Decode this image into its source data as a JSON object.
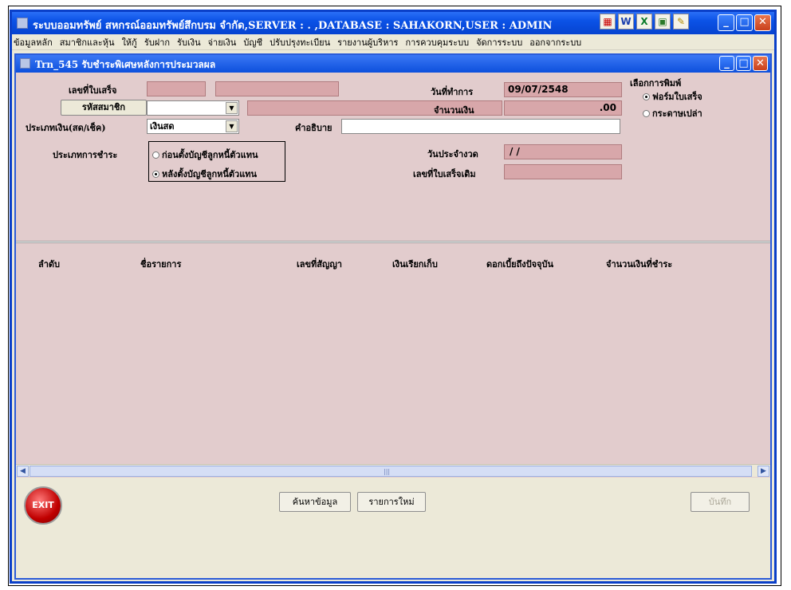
{
  "window": {
    "title": "ระบบออมทรัพย์  สหกรณ์ออมทรัพย์สึกบรม จำกัด,SERVER : . ,DATABASE : SAHAKORN,USER : ADMIN"
  },
  "toolbar_icons": [
    "grid-icon",
    "word-icon",
    "excel-icon",
    "calculator-icon",
    "key-icon"
  ],
  "menu": {
    "items": [
      "ข้อมูลหลัก",
      "สมาชิกและหุ้น",
      "ให้กู้",
      "รับฝาก",
      "รับเงิน",
      "จ่ายเงิน",
      "บัญชี",
      "ปรับปรุงทะเบียน",
      "รายงานผู้บริหาร",
      "การควบคุมระบบ",
      "จัดการระบบ",
      "ออกจากระบบ"
    ]
  },
  "form": {
    "title": "Trn_545 รับชำระพิเศษหลังการประมวลผล",
    "receipt_no_label": "เลขที่ใบเสร็จ",
    "member_code_button": "รหัสสมาชิก",
    "payment_type_label": "ประเภทเงิน(สด/เช็ค)",
    "payment_type_value": "เงินสด",
    "description_label": "คำอธิบาย",
    "payment_kind_label": "ประเภทการชำระ",
    "payment_kind_options": [
      "ก่อนตั้งบัญชีลูกหนี้ตัวแทน",
      "หลังตั้งบัญชีลูกหนี้ตัวแทน"
    ],
    "payment_kind_selected": 1,
    "transaction_date_label": "วันที่ทำการ",
    "transaction_date_value": "09/07/2548",
    "amount_label": "จำนวนเงิน",
    "amount_value": ".00",
    "period_date_label": "วันประจำงวด",
    "period_date_value": " /  /",
    "old_receipt_label": "เลขที่ใบเสร็จเดิม",
    "print_label": "เลือกการพิมพ์",
    "print_options": [
      "ฟอร์มใบเสร็จ",
      "กระดาษเปล่า"
    ],
    "print_selected": 0
  },
  "table": {
    "columns": [
      "ลำดับ",
      "ชื่อรายการ",
      "เลขที่สัญญา",
      "เงินเรียกเก็บ",
      "ดอกเบี้ยถึงปัจจุบัน",
      "จำนวนเงินที่ชำระ"
    ]
  },
  "footer": {
    "exit_label": "EXIT",
    "search_button": "ค้นหาข้อมูล",
    "new_button": "รายการใหม่",
    "save_button": "บันทึก"
  }
}
